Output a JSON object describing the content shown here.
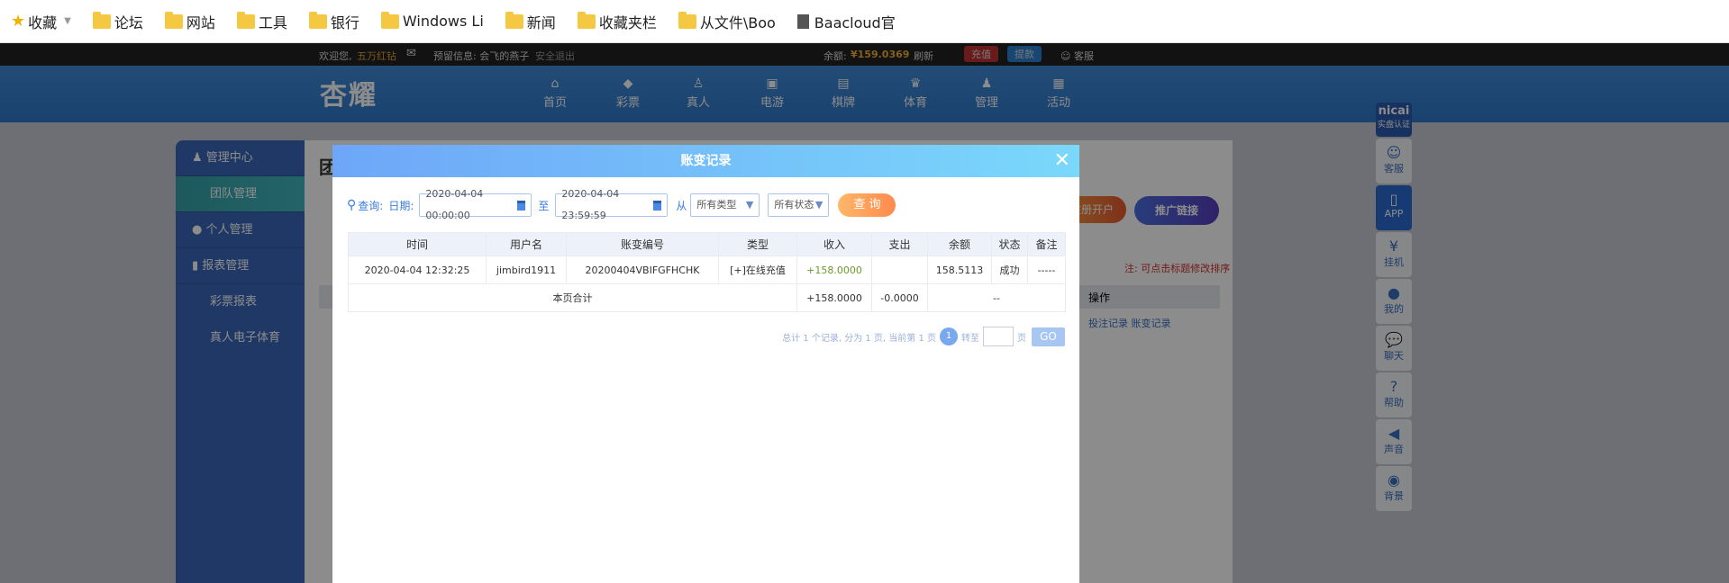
{
  "bookmarks": [
    {
      "label": "收藏",
      "icon": "star-icon"
    },
    {
      "label": "论坛",
      "icon": "folder-icon"
    },
    {
      "label": "网站",
      "icon": "folder-icon"
    },
    {
      "label": "工具",
      "icon": "folder-icon"
    },
    {
      "label": "银行",
      "icon": "folder-icon"
    },
    {
      "label": "Windows Li",
      "icon": "folder-icon"
    },
    {
      "label": "新闻",
      "icon": "folder-icon"
    },
    {
      "label": "收藏夹栏",
      "icon": "folder-icon"
    },
    {
      "label": "从文件\\Boo",
      "icon": "folder-icon"
    },
    {
      "label": "Baacloud官",
      "icon": "page-icon"
    }
  ],
  "topbar": {
    "welcome": "欢迎您,",
    "user": "五万红钻",
    "reserved": "预留信息: 会飞的燕子",
    "logout": "安全退出",
    "balance_label": "余额:",
    "balance": "¥159.0369",
    "refresh": "刷新",
    "deposit": "充值",
    "withdraw": "提款",
    "service": "客服"
  },
  "header": {
    "logo": "杏耀",
    "nav": [
      "首页",
      "彩票",
      "真人",
      "电游",
      "棋牌",
      "体育",
      "管理",
      "活动"
    ]
  },
  "sidebar": {
    "items": [
      "管理中心",
      "团队管理",
      "个人管理",
      "报表管理",
      "彩票报表",
      "真人电子体育"
    ]
  },
  "content": {
    "title": "团",
    "register": "注册开户",
    "promo": "推广链接",
    "note": "注: 可点击标题修改排序",
    "op_header": "操作",
    "op_links": [
      "投注记录",
      "账变记录"
    ]
  },
  "right_sidebar": [
    "客服",
    "APP",
    "挂机",
    "我的",
    "聊天",
    "帮助",
    "声音",
    "背景"
  ],
  "right_badge": {
    "logo": "nicai",
    "sub": "实盘认证"
  },
  "modal": {
    "title": "账变记录",
    "query_label": "查询:",
    "date_label": "日期:",
    "start": "2020-04-04 00:00:00",
    "to": "至",
    "end": "2020-04-04 23:59:59",
    "from": "从",
    "type_select": "所有类型",
    "status_select": "所有状态",
    "search": "查 询",
    "columns": [
      "时间",
      "用户名",
      "账变编号",
      "类型",
      "收入",
      "支出",
      "余额",
      "状态",
      "备注"
    ],
    "rows": [
      [
        "2020-04-04 12:32:25",
        "jimbird1911",
        "20200404VBIFGFHCHK",
        "[+]在线充值",
        "+158.0000",
        "",
        "158.5113",
        "成功",
        "-----"
      ]
    ],
    "total": {
      "label": "本页合计",
      "income": "+158.0000",
      "expense": "-0.0000",
      "balance": "--"
    },
    "pager": {
      "summary": "总计 1 个记录, 分为 1 页, 当前第 1 页",
      "current": "1",
      "goto": "转至",
      "page": "页",
      "go": "GO"
    }
  }
}
